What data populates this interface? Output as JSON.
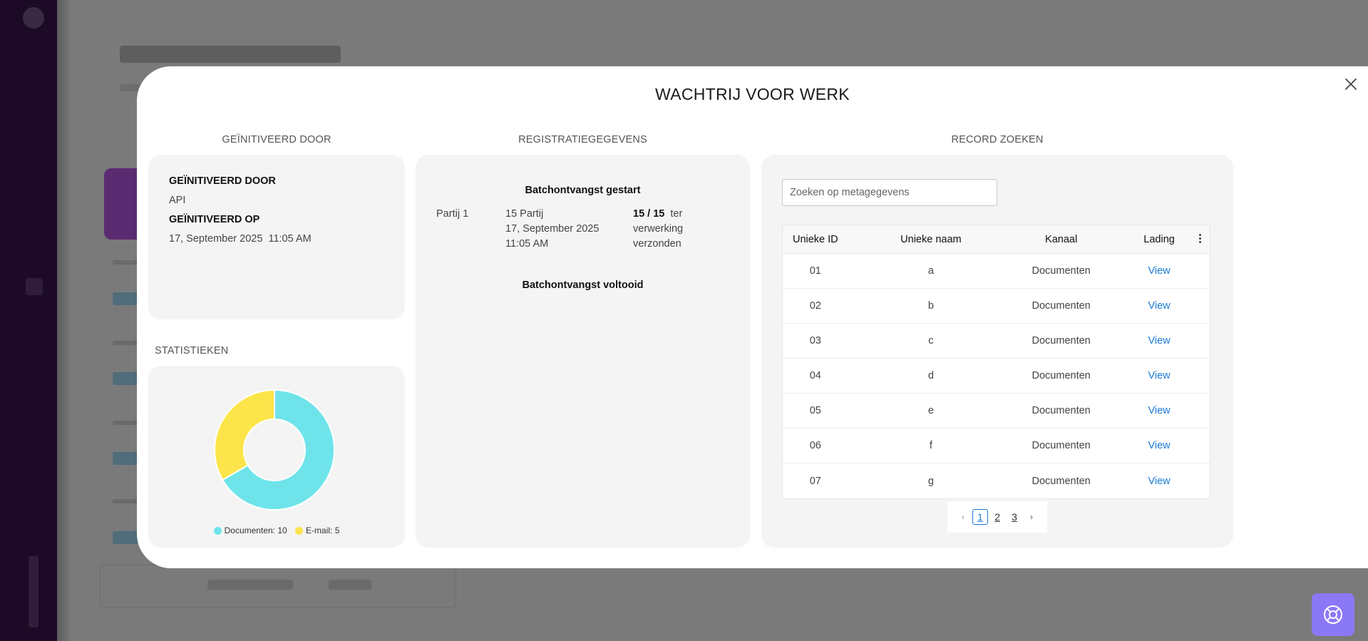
{
  "modal": {
    "title": "WACHTRIJ VOOR WERK"
  },
  "initiated": {
    "section_label": "GEÏNITIVEERD DOOR",
    "by_heading": "GEÏNITIVEERD DOOR",
    "by_value": "API",
    "on_heading": "GEÏNITIVEERD OP",
    "on_value": "17, September 2025  11:05 AM"
  },
  "statistics": {
    "section_label": "STATISTIEKEN",
    "legend": [
      {
        "label": "Documenten: 10",
        "color": "#6ee4ea"
      },
      {
        "label": "E-mail: 5",
        "color": "#fce54a"
      }
    ]
  },
  "chart_data": {
    "type": "pie",
    "categories": [
      "Documenten",
      "E-mail"
    ],
    "values": [
      10,
      5
    ],
    "colors": [
      "#6ee4ea",
      "#fce54a"
    ],
    "donut": true
  },
  "registration": {
    "section_label": "REGISTRATIEGEGEVENS",
    "start_heading": "Batchontvangst gestart",
    "batch_label": "Partij 1",
    "batch_count": "15 Partij",
    "batch_date": "17, September 2025",
    "batch_time": "11:05 AM",
    "progress_bold": "15 / 15",
    "progress_text_1": "ter",
    "progress_text_2": "verwerking",
    "progress_text_3": "verzonden",
    "end_heading": "Batchontvangst voltooid"
  },
  "search": {
    "section_label": "RECORD ZOEKEN",
    "placeholder": "Zoeken op metagegevens",
    "value": "",
    "columns": [
      "Unieke ID",
      "Unieke naam",
      "Kanaal",
      "Lading"
    ],
    "rows": [
      {
        "id": "01",
        "name": "a",
        "channel": "Documenten",
        "action": "View"
      },
      {
        "id": "02",
        "name": "b",
        "channel": "Documenten",
        "action": "View"
      },
      {
        "id": "03",
        "name": "c",
        "channel": "Documenten",
        "action": "View"
      },
      {
        "id": "04",
        "name": "d",
        "channel": "Documenten",
        "action": "View"
      },
      {
        "id": "05",
        "name": "e",
        "channel": "Documenten",
        "action": "View"
      },
      {
        "id": "06",
        "name": "f",
        "channel": "Documenten",
        "action": "View"
      },
      {
        "id": "07",
        "name": "g",
        "channel": "Documenten",
        "action": "View"
      }
    ],
    "pagination": {
      "pages": [
        "1",
        "2",
        "3"
      ],
      "current": "1",
      "prev_icon": "chevron-left-icon",
      "next_icon": "chevron-right-icon"
    }
  },
  "icons": {
    "close": "close-icon",
    "help": "lifebuoy-icon",
    "more": "kebab-menu-icon"
  },
  "colors": {
    "accent": "#1a7ad6",
    "help_button": "#8b78f7",
    "card_bg": "#f4f4f4"
  }
}
